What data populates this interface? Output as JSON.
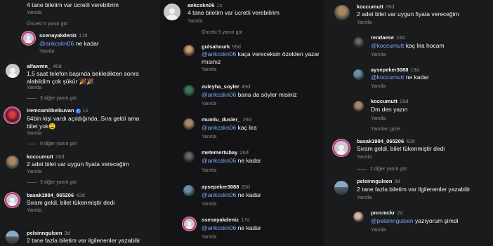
{
  "col1": {
    "top_text": "4 tane biletim var ücretli verebilirim",
    "top_reply": "Yanıtla",
    "prev_replies": "Önceki 5 yanıtı gör",
    "c1": {
      "user": "ssenayakdeniz",
      "time": "17d",
      "mention": "@ankcskn06",
      "text": " ne kadar",
      "reply": "Yanıtla"
    },
    "c2": {
      "user": "alfawmn_",
      "time": "40d",
      "text": "1.5 saat telefon başında  bekledikten sonra alabildim çok şükür 🎉🎉",
      "reply": "Yanıtla",
      "more": "3 diğer yanıtı gör"
    },
    "c3": {
      "user": "iremcamlibelkuvan",
      "verified": "✓",
      "time": "1s",
      "text": "64bin kişi vardı açıldığında..Sıra geldi ama bilet yok😩",
      "reply": "Yanıtla",
      "more": "9 diğer yanıtı gör"
    },
    "c4": {
      "user": "koccumutt",
      "time": "26d",
      "text": "2 adet bilet var uygun fiyata vereceğim",
      "reply": "Yanıtla",
      "more": "3 diğer yanıtı gör"
    },
    "c5": {
      "user": "basak1984_065206",
      "time": "42d",
      "text": "Sıram geldi, bilet tükenmiştir dedi",
      "reply": "Yanıtla"
    },
    "c6": {
      "user": "pelsinngulsen",
      "time": "3d",
      "text": "2 tane fazla biletim var ilgilenenler yazabilir"
    }
  },
  "col2": {
    "c0": {
      "user": "ankcskn06",
      "time": "1s",
      "text": "4 tane biletim var ücretli verebilirim",
      "reply": "Yanıtla"
    },
    "prev_replies": "Önceki 5 yanıtı gör",
    "c1": {
      "user": "gulsahnurk",
      "time": "55d",
      "mention": "@ankcskn06",
      "text": " kaça vereceksin özelden yazar mısınız",
      "reply": "Yanıtla"
    },
    "c2": {
      "user": "zuleyha_soyler",
      "time": "49d",
      "mention": "@ankcskn06",
      "text": " bana da söyler misiniz",
      "reply": "Yanıtla"
    },
    "c3": {
      "user": "mumlu_dusler_",
      "time": "29d",
      "mention": "@ankcskn06",
      "text": " kaç lira",
      "reply": "Yanıtla"
    },
    "c4": {
      "user": "metemertubay",
      "time": "26d",
      "mention": "@ankcskn06",
      "text": " ne kadar",
      "reply": "Yanıtla"
    },
    "c5": {
      "user": "aysepeker3088",
      "time": "20d",
      "mention": "@ankcskn06",
      "text": " ne kadar",
      "reply": "Yanıtla"
    },
    "c6": {
      "user": "ssenayakdeniz",
      "time": "17d",
      "mention": "@ankcskn06",
      "text": " ne kadar",
      "reply": "Yanıtla"
    }
  },
  "col3": {
    "c0": {
      "user": "koccumutt",
      "time": "26d",
      "text": "2 adet bilet var uygun fiyata vereceğim",
      "reply": "Yanıtla"
    },
    "c1": {
      "user": "rendaese",
      "time": "24d",
      "mention": "@koccumutt",
      "text": " kaç lira hocam",
      "reply": "Yanıtla"
    },
    "c2": {
      "user": "aysepeker3088",
      "time": "19d",
      "mention": "@koccumutt",
      "text": " ne kadar",
      "reply": "Yanıtla"
    },
    "c3": {
      "user": "koccumutt",
      "time": "19d",
      "text": "Dm den yazın",
      "reply": "Yanıtla"
    },
    "hide": "Yanıtları gizle",
    "c4": {
      "user": "basak1984_065206",
      "time": "42d",
      "text": "Sıram geldi, bilet tükenmiştir dedi",
      "reply": "Yanıtla",
      "more": "2 diğer yanıtı gör"
    },
    "c5": {
      "user": "pelsinngulsen",
      "time": "3d",
      "text": "2 tane fazla biletim var ilgilenenler yazabilir",
      "reply": "Yanıtla"
    },
    "c6": {
      "user": "pnrcmckr",
      "time": "2d",
      "mention": "@pelsinngulsen",
      "text": " yazıyorum şimdi",
      "reply": "Yanıtla"
    }
  }
}
